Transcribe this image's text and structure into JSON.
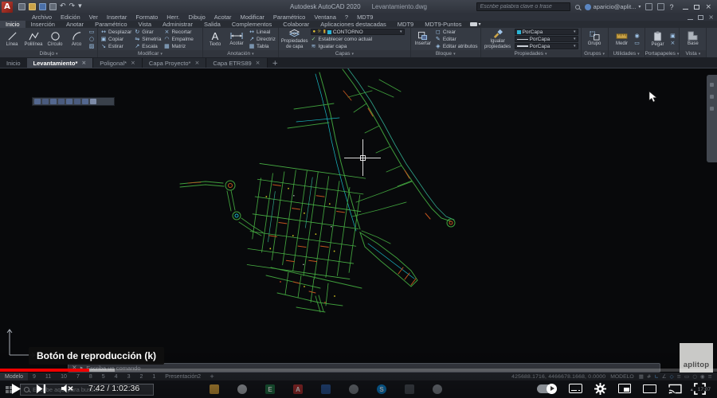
{
  "titlebar": {
    "app_title": "Autodesk AutoCAD 2020",
    "doc_title": "Levantamiento.dwg",
    "search_placeholder": "Escribe palabra clave o frase",
    "account": "aparicio@aplit...",
    "help_label": "?"
  },
  "menubar": {
    "items": [
      "Archivo",
      "Edición",
      "Ver",
      "Insertar",
      "Formato",
      "Herr.",
      "Dibujo",
      "Acotar",
      "Modificar",
      "Paramétrico",
      "Ventana",
      "?",
      "MDT9"
    ]
  },
  "ribbon_tabs": [
    "Inicio",
    "Inserción",
    "Anotar",
    "Paramétrico",
    "Vista",
    "Administrar",
    "Salida",
    "Complementos",
    "Colaborar",
    "Aplicaciones destacadas",
    "MDT9",
    "MDT9-Puntos"
  ],
  "ribbon": {
    "dibujo": {
      "label": "Dibujo",
      "linea": "Línea",
      "polilinea": "Polilínea",
      "circulo": "Círculo",
      "arco": "Arco"
    },
    "modificar": {
      "label": "Modificar",
      "desplazar": "Desplazar",
      "copiar": "Copiar",
      "estirar": "Estirar",
      "girar": "Girar",
      "simetria": "Simetría",
      "escala": "Escala",
      "recortar": "Recortar",
      "empalme": "Empalme",
      "matriz": "Matriz"
    },
    "anotacion": {
      "label": "Anotación",
      "texto": "Texto",
      "acotar": "Acotar",
      "lineal": "Lineal",
      "directriz": "Directriz",
      "tabla": "Tabla"
    },
    "capas": {
      "label": "Capas",
      "propiedades_capa": "Propiedades\nde capa",
      "layer_actual": "CONTORNO",
      "establecer": "Establecer como actual",
      "igualar": "Igualar capa"
    },
    "bloque": {
      "label": "Bloque",
      "insertar": "Insertar",
      "crear": "Crear",
      "editar": "Editar",
      "editar_atributos": "Editar atributos"
    },
    "propiedades": {
      "label": "Propiedades",
      "igualar_propiedades": "Igualar\npropiedades",
      "color": "PorCapa",
      "tipo_linea": "PorCapa",
      "grosor_linea": "PorCapa"
    },
    "grupos": {
      "label": "Grupos",
      "grupo": "Grupo"
    },
    "utilidades": {
      "label": "Utilidades",
      "medir": "Medir"
    },
    "portapapeles": {
      "label": "Portapapeles",
      "pegar": "Pegar"
    },
    "vista": {
      "label": "Vista",
      "base": "Base"
    }
  },
  "file_tabs": {
    "inicio": "Inicio",
    "t1": "Levantamiento*",
    "t2": "Poligonal*",
    "t3": "Capa Proyecto*",
    "t4": "Capa ETRS89"
  },
  "command_line": {
    "prompt": "Escriba un comando"
  },
  "layout_bar": {
    "tabs": [
      "Modelo",
      "9",
      "11",
      "10",
      "7",
      "8",
      "5",
      "4",
      "3",
      "2",
      "1",
      "Presentación2"
    ],
    "add": "+"
  },
  "status_bar": {
    "coords": "425688.1716, 4466678.1668, 0.0000",
    "space": "MODELO"
  },
  "player": {
    "tooltip": "Botón de reproducción (k)",
    "time": "7:42 / 1:02:36",
    "progress_pct": 12.4,
    "buffer_pct": 16,
    "watermark": "aplitop"
  },
  "taskbar": {
    "search_placeholder": "Escribe aquí para buscar",
    "clock": "17:07"
  },
  "colors": {
    "youtube_red": "#f00000",
    "map_green": "#3f9e3c",
    "map_cyan": "#19b8c4",
    "map_orange": "#c1541e",
    "map_yellow": "#d2c21f",
    "layer_swatch": "#29b5d6",
    "autocad_logo_red": "#c03030"
  }
}
